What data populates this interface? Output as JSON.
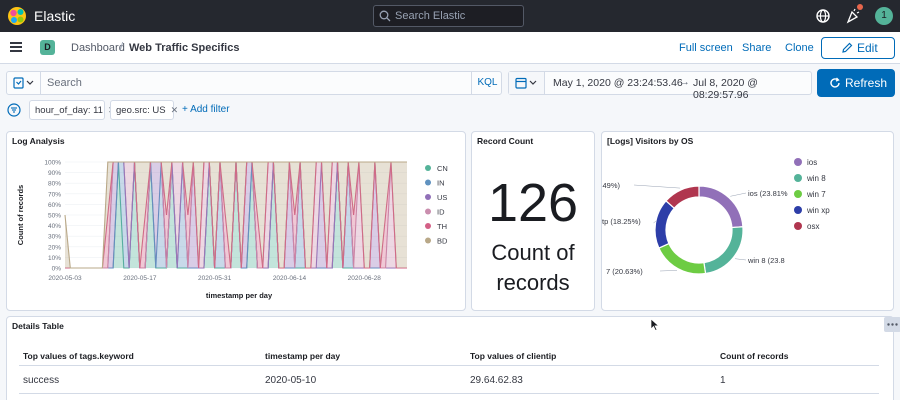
{
  "app": {
    "brand": "Elastic",
    "search_placeholder": "Search Elastic",
    "avatar": "1"
  },
  "breadcrumb": {
    "space": "D",
    "items": [
      "Dashboard",
      "Web Traffic Specifics"
    ],
    "separator": "/"
  },
  "header_actions": {
    "fullscreen": "Full screen",
    "share": "Share",
    "clone": "Clone",
    "edit": "Edit"
  },
  "query": {
    "placeholder": "Search",
    "language": "KQL"
  },
  "time": {
    "start": "May 1, 2020 @ 23:24:53.46",
    "end": "Jul 8, 2020 @ 08:29:57.96",
    "arrow": "→",
    "refresh": "Refresh"
  },
  "filters": {
    "pills": [
      "hour_of_day: 11",
      "geo.src: US"
    ],
    "add": "+ Add filter"
  },
  "panels": {
    "log": {
      "title": "Log Analysis"
    },
    "count": {
      "title": "Record Count",
      "value": "126",
      "label": "Count of records"
    },
    "visitors": {
      "title": "[Logs] Visitors by OS"
    },
    "details": {
      "title": "Details Table"
    }
  },
  "colors": {
    "blue": "#006bb8",
    "topbar": "#25282f",
    "green": "#54b399"
  },
  "chart_data": [
    {
      "type": "area",
      "title": "Log Analysis",
      "xlabel": "timestamp per day",
      "ylabel": "Count of records",
      "x_ticks": [
        "2020-05-03",
        "2020-05-17",
        "2020-05-31",
        "2020-06-14",
        "2020-06-28"
      ],
      "y_ticks": [
        "100%",
        "90%",
        "80%",
        "70%",
        "60%",
        "50%",
        "40%",
        "30%",
        "20%",
        "10%",
        "0%"
      ],
      "ylim": [
        0,
        100
      ],
      "stacked": "percentage",
      "legend": [
        "CN",
        "IN",
        "US",
        "ID",
        "TH",
        "BD"
      ],
      "legend_position": "right",
      "colors": [
        "#54b399",
        "#6092c0",
        "#9170b8",
        "#ca8eae",
        "#d36086",
        "#b9a888"
      ],
      "x": [
        "05-03",
        "05-04",
        "05-05",
        "05-06",
        "05-07",
        "05-08",
        "05-09",
        "05-10",
        "05-11",
        "05-12",
        "05-13",
        "05-14",
        "05-15",
        "05-16",
        "05-17",
        "05-18",
        "05-19",
        "05-20",
        "05-21",
        "05-22",
        "05-23",
        "05-24",
        "05-25",
        "05-26",
        "05-27",
        "05-28",
        "05-29",
        "05-30",
        "05-31",
        "06-01",
        "06-02",
        "06-03",
        "06-04",
        "06-05",
        "06-06",
        "06-07",
        "06-08",
        "06-09",
        "06-10",
        "06-11",
        "06-12",
        "06-13",
        "06-14",
        "06-15",
        "06-16",
        "06-17",
        "06-18",
        "06-19",
        "06-20",
        "06-21",
        "06-22",
        "06-23",
        "06-24",
        "06-25",
        "06-26",
        "06-27",
        "06-28",
        "06-29",
        "06-30",
        "07-01",
        "07-02",
        "07-03",
        "07-04",
        "07-05",
        "07-06"
      ],
      "series": [
        {
          "name": "CN",
          "values": [
            0,
            0,
            0,
            0,
            0,
            0,
            0,
            0,
            0,
            0,
            100,
            0,
            0,
            100,
            0,
            0,
            100,
            0,
            0,
            0,
            100,
            0,
            0,
            0,
            0,
            0,
            0,
            100,
            0,
            0,
            0,
            0,
            100,
            0,
            0,
            100,
            0,
            0,
            0,
            100,
            0,
            0,
            0,
            0,
            0,
            0,
            0,
            0,
            0,
            0,
            0,
            100,
            0,
            0,
            0,
            0,
            0,
            0,
            0,
            0,
            0,
            0,
            0,
            0,
            0
          ]
        },
        {
          "name": "IN",
          "values": [
            0,
            0,
            0,
            0,
            0,
            0,
            0,
            0,
            0,
            0,
            0,
            100,
            0,
            0,
            0,
            0,
            0,
            0,
            100,
            0,
            0,
            0,
            100,
            0,
            0,
            0,
            0,
            0,
            0,
            100,
            0,
            0,
            0,
            0,
            0,
            0,
            0,
            0,
            0,
            0,
            0,
            0,
            0,
            0,
            100,
            0,
            0,
            0,
            0,
            0,
            0,
            0,
            0,
            100,
            0,
            0,
            0,
            0,
            0,
            0,
            0,
            0,
            0,
            0,
            0
          ]
        },
        {
          "name": "US",
          "values": [
            0,
            0,
            0,
            0,
            0,
            0,
            0,
            0,
            0,
            100,
            0,
            0,
            0,
            0,
            0,
            0,
            0,
            100,
            0,
            0,
            0,
            0,
            0,
            0,
            100,
            0,
            0,
            0,
            0,
            0,
            0,
            0,
            0,
            0,
            100,
            0,
            0,
            0,
            0,
            0,
            0,
            0,
            100,
            0,
            0,
            0,
            0,
            0,
            100,
            0,
            0,
            0,
            0,
            0,
            0,
            0,
            0,
            0,
            100,
            0,
            0,
            0,
            0,
            0,
            0
          ]
        },
        {
          "name": "ID",
          "values": [
            0,
            0,
            0,
            0,
            0,
            0,
            0,
            0,
            0,
            0,
            0,
            0,
            100,
            0,
            0,
            0,
            0,
            0,
            0,
            0,
            0,
            100,
            0,
            0,
            0,
            0,
            100,
            0,
            0,
            0,
            0,
            0,
            0,
            0,
            0,
            0,
            0,
            0,
            100,
            0,
            0,
            0,
            0,
            0,
            0,
            0,
            0,
            100,
            0,
            0,
            100,
            0,
            0,
            0,
            0,
            100,
            0,
            0,
            0,
            0,
            0,
            100,
            0,
            0,
            0
          ]
        },
        {
          "name": "TH",
          "values": [
            0,
            0,
            0,
            0,
            0,
            0,
            0,
            0,
            50,
            0,
            0,
            0,
            0,
            0,
            0,
            50,
            0,
            0,
            0,
            50,
            0,
            0,
            0,
            50,
            0,
            0,
            0,
            0,
            0,
            0,
            50,
            0,
            0,
            0,
            0,
            0,
            50,
            0,
            0,
            0,
            0,
            0,
            0,
            50,
            0,
            0,
            0,
            0,
            0,
            0,
            0,
            0,
            0,
            0,
            50,
            0,
            0,
            0,
            0,
            0,
            50,
            0,
            0,
            0,
            0
          ]
        },
        {
          "name": "BD",
          "values": [
            50,
            0,
            0,
            0,
            0,
            0,
            0,
            0,
            50,
            0,
            0,
            0,
            0,
            0,
            100,
            50,
            0,
            0,
            0,
            50,
            0,
            0,
            0,
            50,
            0,
            100,
            0,
            0,
            100,
            0,
            50,
            100,
            0,
            100,
            0,
            0,
            50,
            100,
            0,
            0,
            100,
            100,
            0,
            50,
            0,
            100,
            100,
            0,
            0,
            100,
            0,
            0,
            100,
            0,
            50,
            0,
            100,
            100,
            0,
            100,
            50,
            0,
            100,
            100,
            100
          ]
        }
      ]
    },
    {
      "type": "pie",
      "title": "[Logs] Visitors by OS",
      "donut": true,
      "legend_position": "right",
      "legend": [
        "ios",
        "win 8",
        "win 7",
        "win xp",
        "osx"
      ],
      "values": [
        23.81,
        23.81,
        20.63,
        18.25,
        13.49
      ],
      "colors": [
        "#9170b8",
        "#54b399",
        "#6dcc43",
        "#2d3ea8",
        "#b0364f"
      ],
      "labels": [
        "ios (23.81%",
        "win 8 (23.8",
        "7 (20.63%)",
        "tp (18.25%)",
        "sx (13.49%)"
      ]
    }
  ],
  "table": {
    "headers": [
      "Top values of tags.keyword",
      "timestamp per day",
      "Top values of clientip",
      "Count of records"
    ],
    "rows": [
      [
        "success",
        "2020-05-10",
        "29.64.62.83",
        "1"
      ]
    ]
  }
}
